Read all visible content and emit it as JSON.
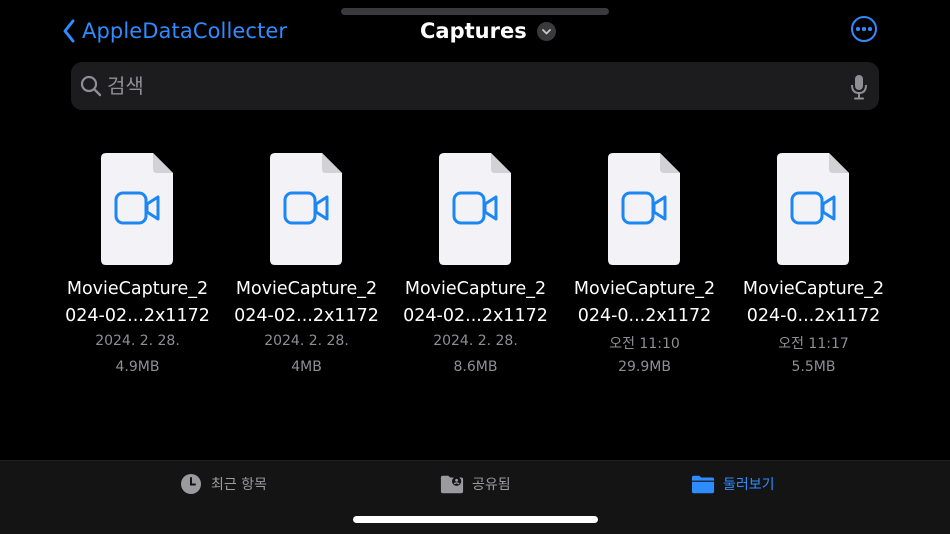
{
  "nav": {
    "back_label": "AppleDataCollecter",
    "title": "Captures"
  },
  "search": {
    "placeholder": "검색",
    "value": ""
  },
  "files": [
    {
      "name": "MovieCapture_2\n024-02...2x1172",
      "date": "2024. 2. 28.",
      "size": "4.9MB"
    },
    {
      "name": "MovieCapture_2\n024-02...2x1172",
      "date": "2024. 2. 28.",
      "size": "4MB"
    },
    {
      "name": "MovieCapture_2\n024-02...2x1172",
      "date": "2024. 2. 28.",
      "size": "8.6MB"
    },
    {
      "name": "MovieCapture_2\n024-0...2x1172",
      "date": "오전 11:10",
      "size": "29.9MB"
    },
    {
      "name": "MovieCapture_2\n024-0...2x1172",
      "date": "오전 11:17",
      "size": "5.5MB"
    }
  ],
  "tabs": {
    "recents": "최근 항목",
    "shared": "공유됨",
    "browse": "둘러보기"
  },
  "colors": {
    "accent": "#2f8cff",
    "background": "#000000",
    "secondary_text": "#8e8e93"
  }
}
